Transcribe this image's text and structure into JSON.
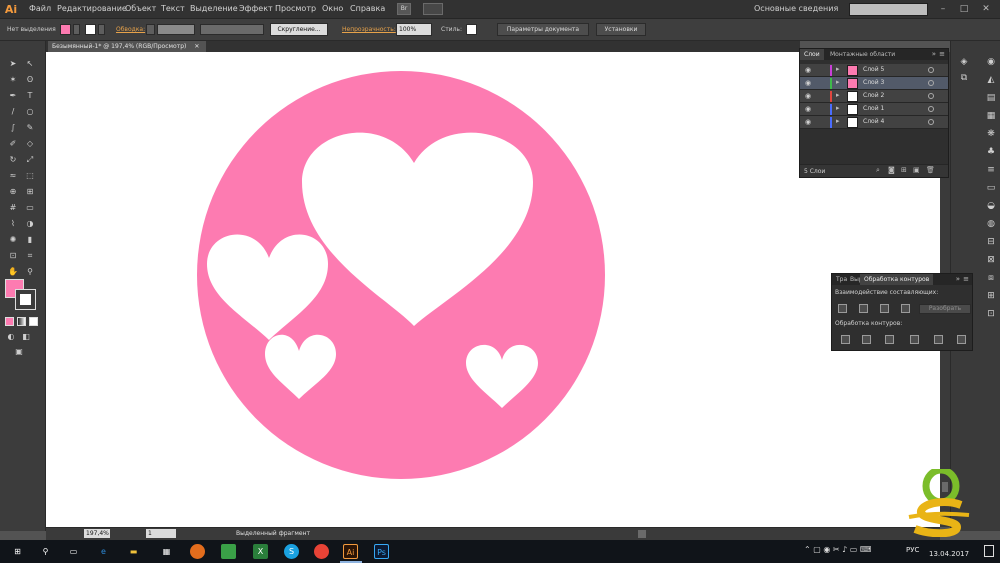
{
  "app": {
    "logo": "Ai"
  },
  "menu": [
    "Файл",
    "Редактирование",
    "Объект",
    "Текст",
    "Выделение",
    "Эффект",
    "Просмотр",
    "Окно",
    "Справка"
  ],
  "menubar": {
    "br_button": "Br",
    "workspace": "Основные сведения",
    "search_placeholder": ""
  },
  "control_bar": {
    "selection_label": "Нет выделения",
    "stroke_label": "Обводка:",
    "profile_label": "Скругление...",
    "opacity_label": "Непрозрачность:",
    "opacity_value": "100%",
    "style_label": "Стиль:",
    "doc_setup_button": "Параметры документа",
    "prefs_button": "Установки"
  },
  "document": {
    "tab_title": "Безымянный-1* @ 197,4% (RGB/Просмотр)"
  },
  "artwork": {
    "circle_color": "#fd7bb1",
    "heart_color": "#ffffff",
    "hearts": [
      "large-heart",
      "left-heart",
      "small-bottom-heart",
      "small-right-heart"
    ]
  },
  "colors": {
    "fill_swatch": "#fd7bb1",
    "accent": "#e7a24a"
  },
  "layers_panel": {
    "tabs": [
      "Слои",
      "Монтажные области"
    ],
    "layers": [
      {
        "name": "Слой 5",
        "color": "#c93fd8",
        "thumb": "pink",
        "selected": false
      },
      {
        "name": "Слой 3",
        "color": "#3fba4a",
        "thumb": "pink-heart",
        "selected": true
      },
      {
        "name": "Слой 2",
        "color": "#e0463f",
        "thumb": "white",
        "selected": false
      },
      {
        "name": "Слой 1",
        "color": "#4a6cff",
        "thumb": "white",
        "selected": false
      },
      {
        "name": "Слой 4",
        "color": "#4a6cff",
        "thumb": "white",
        "selected": false
      }
    ],
    "count_label": "5 Слои"
  },
  "pathfinder_panel": {
    "tabs": [
      "Тра",
      "Выр",
      "Обработка контуров"
    ],
    "shape_modes_label": "Взаимодействие составляющих:",
    "expand_button": "Разобрать",
    "pathfinders_label": "Обработка контуров:"
  },
  "status_bar": {
    "zoom": "197,4%",
    "page": "1",
    "status_text": "Выделенный фрагмент"
  },
  "taskbar": {
    "language": "РУС",
    "date": "13.04.2017"
  }
}
